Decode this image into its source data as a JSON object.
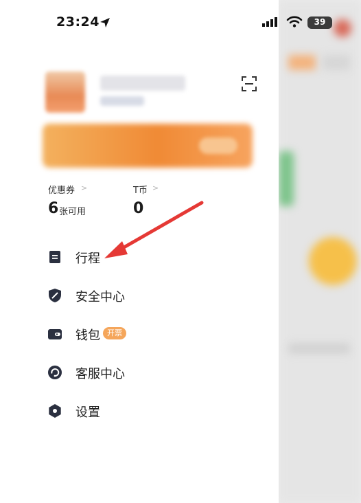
{
  "status_bar": {
    "time": "23:24",
    "battery": "39"
  },
  "wallet_stats": {
    "coupons": {
      "label": "优惠券",
      "count": "6",
      "unit": "张可用"
    },
    "t_coins": {
      "label": "T币",
      "count": "0"
    }
  },
  "menu": [
    {
      "label": "行程",
      "icon": "document-icon"
    },
    {
      "label": "安全中心",
      "icon": "shield-icon"
    },
    {
      "label": "钱包",
      "icon": "wallet-icon",
      "badge": "开票"
    },
    {
      "label": "客服中心",
      "icon": "headset-icon"
    },
    {
      "label": "设置",
      "icon": "gear-icon"
    }
  ],
  "colors": {
    "accent_orange": "#f08a35",
    "badge_orange": "#f5a65b",
    "annotation_red": "#e53935",
    "icon_dark": "#2b3040"
  }
}
